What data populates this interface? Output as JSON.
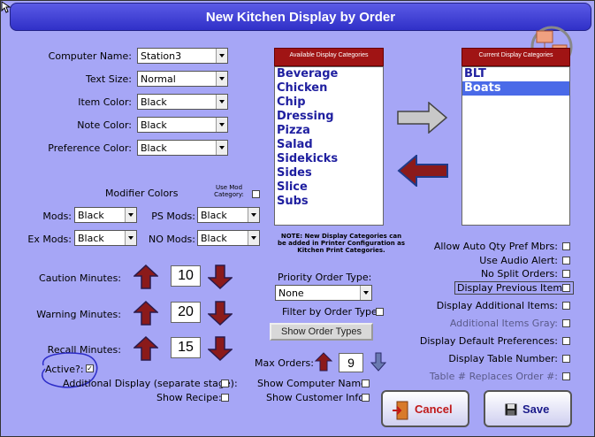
{
  "window": {
    "title": "New Kitchen Display by Order"
  },
  "left": {
    "computer_name": {
      "label": "Computer Name:",
      "value": "Station3"
    },
    "text_size": {
      "label": "Text Size:",
      "value": "Normal"
    },
    "item_color": {
      "label": "Item Color:",
      "value": "Black"
    },
    "note_color": {
      "label": "Note Color:",
      "value": "Black"
    },
    "preference_color": {
      "label": "Preference Color:",
      "value": "Black"
    },
    "modifier_colors": {
      "label": "Modifier Colors"
    },
    "use_mod_category": {
      "label": "Use Mod Category:",
      "checked": false
    },
    "mods": {
      "label": "Mods:",
      "value": "Black"
    },
    "ps_mods": {
      "label": "PS Mods:",
      "value": "Black"
    },
    "ex_mods": {
      "label": "Ex Mods:",
      "value": "Black"
    },
    "no_mods": {
      "label": "NO Mods:",
      "value": "Black"
    },
    "caution_minutes": {
      "label": "Caution Minutes:",
      "value": "10"
    },
    "warning_minutes": {
      "label": "Warning Minutes:",
      "value": "20"
    },
    "recall_minutes": {
      "label": "Recall Minutes:",
      "value": "15"
    },
    "active": {
      "label": "Active?:",
      "checked": true,
      "mark": "✓"
    },
    "additional_display": {
      "label": "Additional Display (separate stage):",
      "checked": false
    },
    "show_recipe": {
      "label": "Show Recipe:",
      "checked": false
    }
  },
  "categories": {
    "available_header": "Available Display Categories",
    "available": [
      "Beverage",
      "Chicken",
      "Chip",
      "Dressing",
      "Pizza",
      "Salad",
      "Sidekicks",
      "Sides",
      "Slice",
      "Subs"
    ],
    "current_header": "Current Display Categories",
    "current": [
      "BLT",
      "Boats"
    ],
    "current_selected": "Boats",
    "note": "NOTE: New Display Categories can be added in Printer Configuration as Kitchen Print Categories."
  },
  "middle": {
    "priority_order_type": {
      "label": "Priority Order Type:",
      "value": "None"
    },
    "filter_by_order_type": {
      "label": "Filter by Order Type:",
      "checked": false
    },
    "show_order_types_button": "Show Order Types",
    "max_orders": {
      "label": "Max Orders:",
      "value": "9"
    },
    "show_computer_name": {
      "label": "Show Computer Name:",
      "checked": false
    },
    "show_customer_info": {
      "label": "Show Customer Info:",
      "checked": false
    }
  },
  "right": {
    "allow_auto_qty": {
      "label": "Allow Auto Qty Pref Mbrs:",
      "checked": false
    },
    "use_audio_alert": {
      "label": "Use Audio Alert:",
      "checked": false
    },
    "no_split_orders": {
      "label": "No Split Orders:",
      "checked": false
    },
    "display_previous_items": {
      "label": "Display Previous Items:",
      "checked": false
    },
    "display_additional_items": {
      "label": "Display Additional Items:",
      "checked": false
    },
    "additional_items_gray": {
      "label": "Additional Items Gray:",
      "checked": false
    },
    "display_default_preferences": {
      "label": "Display Default Preferences:",
      "checked": false
    },
    "display_table_number": {
      "label": "Display Table Number:",
      "checked": false
    },
    "table_replaces_order": {
      "label": "Table # Replaces Order #:",
      "checked": false
    }
  },
  "buttons": {
    "cancel": "Cancel",
    "save": "Save"
  },
  "colors": {
    "accent": "#3a3ad8",
    "background": "#a6a6f6",
    "header_red": "#a01414",
    "arrow_red": "#8b1a1a",
    "arrow_blue": "#1e3a8a"
  }
}
